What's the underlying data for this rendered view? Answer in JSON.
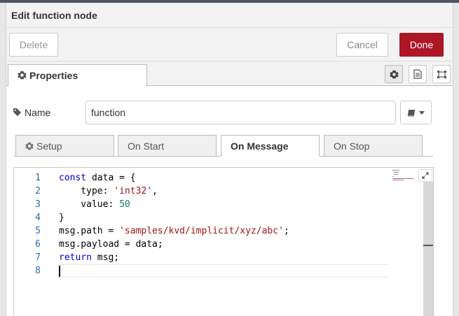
{
  "dialog": {
    "title": "Edit function node",
    "buttons": {
      "delete": "Delete",
      "cancel": "Cancel",
      "done": "Done"
    },
    "tabs": {
      "properties": "Properties"
    },
    "tab_icons": [
      "gear-icon",
      "document-icon",
      "frame-icon"
    ]
  },
  "form": {
    "name_label": "Name",
    "name_value": "function"
  },
  "subtabs": [
    {
      "label": "Setup",
      "icon": "gear-icon",
      "active": false
    },
    {
      "label": "On Start",
      "active": false
    },
    {
      "label": "On Message",
      "active": true
    },
    {
      "label": "On Stop",
      "active": false
    }
  ],
  "editor": {
    "line_numbers": [
      "1",
      "2",
      "3",
      "4",
      "5",
      "6",
      "7",
      "8"
    ],
    "lines": [
      [
        {
          "t": "const",
          "c": "kw"
        },
        {
          "t": " data = {"
        }
      ],
      [
        {
          "t": "    type: "
        },
        {
          "t": "'int32'",
          "c": "str"
        },
        {
          "t": ","
        }
      ],
      [
        {
          "t": "    value: "
        },
        {
          "t": "50",
          "c": "num"
        }
      ],
      [
        {
          "t": "}"
        }
      ],
      [
        {
          "t": "msg.path = "
        },
        {
          "t": "'samples/kvd/implicit/xyz/abc'",
          "c": "str"
        },
        {
          "t": ";"
        }
      ],
      [
        {
          "t": "msg.payload = data;"
        }
      ],
      [
        {
          "t": "return",
          "c": "kw"
        },
        {
          "t": " msg;"
        }
      ],
      []
    ]
  },
  "colors": {
    "done_button": "#ad1625",
    "line_number": "#2b6aa6",
    "keyword": "#0000cc",
    "string": "#a31515",
    "number": "#098658"
  }
}
